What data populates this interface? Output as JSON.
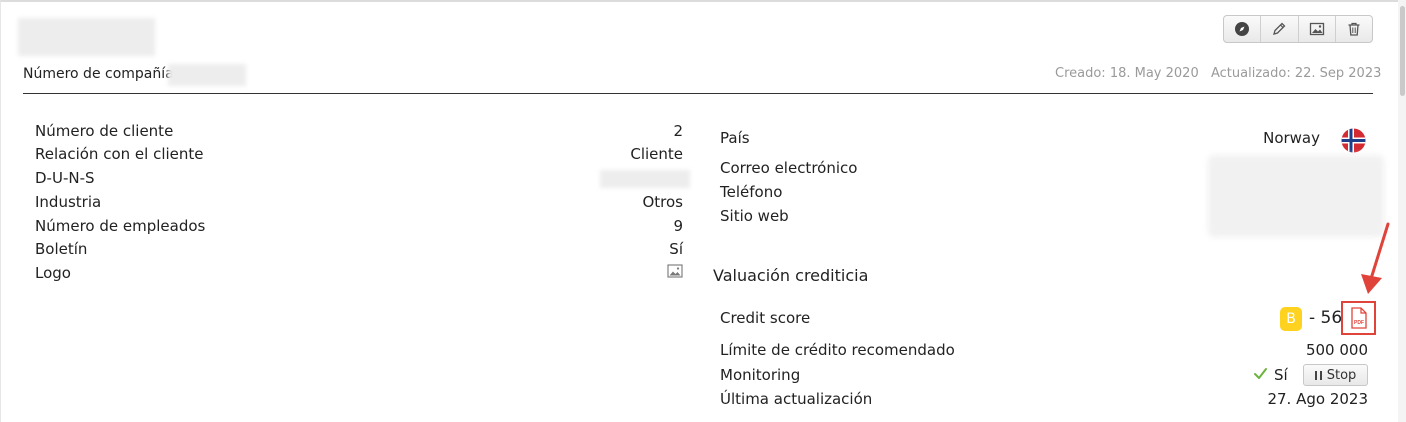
{
  "header": {
    "company_number_label": "Número de compañía:",
    "created": "Creado: 18. May 2020",
    "updated": "Actualizado: 22. Sep 2023"
  },
  "toolbar": {
    "icons": [
      "compass-icon",
      "pencil-icon",
      "image-icon",
      "trash-icon"
    ]
  },
  "left": {
    "rows": [
      {
        "label": "Número de cliente",
        "value": "2"
      },
      {
        "label": "Relación con el cliente",
        "value": "Cliente"
      },
      {
        "label": "D-U-N-S",
        "value": ""
      },
      {
        "label": "Industria",
        "value": "Otros"
      },
      {
        "label": "Número de empleados",
        "value": "9"
      },
      {
        "label": "Boletín",
        "value": "Sí"
      },
      {
        "label": "Logo",
        "value": ""
      }
    ]
  },
  "contact": {
    "country_label": "País",
    "country_value": "Norway",
    "email_label": "Correo electrónico",
    "phone_label": "Teléfono",
    "website_label": "Sitio web"
  },
  "credit": {
    "section_title": "Valuación crediticia",
    "score_label": "Credit score",
    "grade": "B",
    "score": "- 56",
    "limit_label": "Límite de crédito recomendado",
    "limit_value": "500 000",
    "monitoring_label": "Monitoring",
    "monitoring_value": "Sí",
    "stop_label": "Stop",
    "last_update_label": "Última actualización",
    "last_update_value": "27. Ago 2023"
  },
  "colors": {
    "badge": "#ffd21f",
    "highlight": "#e0433a",
    "check": "#6cb33f"
  }
}
